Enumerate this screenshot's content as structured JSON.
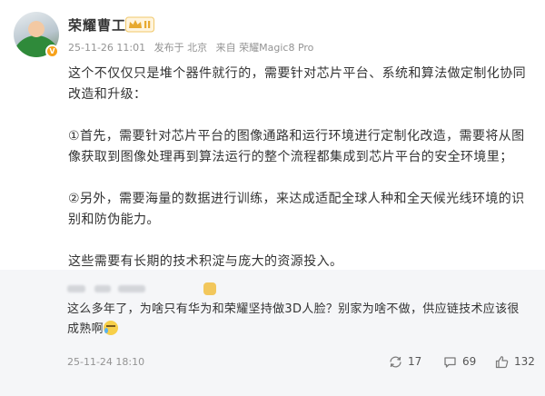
{
  "post": {
    "author": "荣耀曹工",
    "time": "25-11-26 11:01",
    "location": "发布于 北京",
    "source": "来自 荣耀Magic8 Pro",
    "paragraphs": [
      "这个不仅仅只是堆个器件就行的，需要针对芯片平台、系统和算法做定制化协同改造和升级：",
      "①首先，需要针对芯片平台的图像通路和运行环境进行定制化改造，需要将从图像获取到图像处理再到算法运行的整个流程都集成到芯片平台的安全环境里；",
      "②另外，需要海量的数据进行训练，来达成适配全球人种和全天候光线环境的识别和防伪能力。",
      "这些需要有长期的技术积淀与庞大的资源投入。"
    ]
  },
  "comment": {
    "text": "这么多年了，为啥只有华为和荣耀坚持做3D人脸？别家为啥不做，供应链技术应该很成熟啊",
    "time": "25-11-24 18:10",
    "forward_count": "17",
    "comment_count": "69",
    "like_count": "132"
  },
  "icons": {
    "avatar_badge": "v-badge-icon",
    "crown": "crown-badge-icon",
    "forward": "forward-icon",
    "comment": "comment-icon",
    "like": "like-icon",
    "emoji": "sweat-smile-emoji-icon"
  },
  "colors": {
    "badge_orange": "#f7a21b",
    "crown_gold": "#e7a92f",
    "comment_bg": "#f5f6f8",
    "meta_gray": "#939393"
  }
}
